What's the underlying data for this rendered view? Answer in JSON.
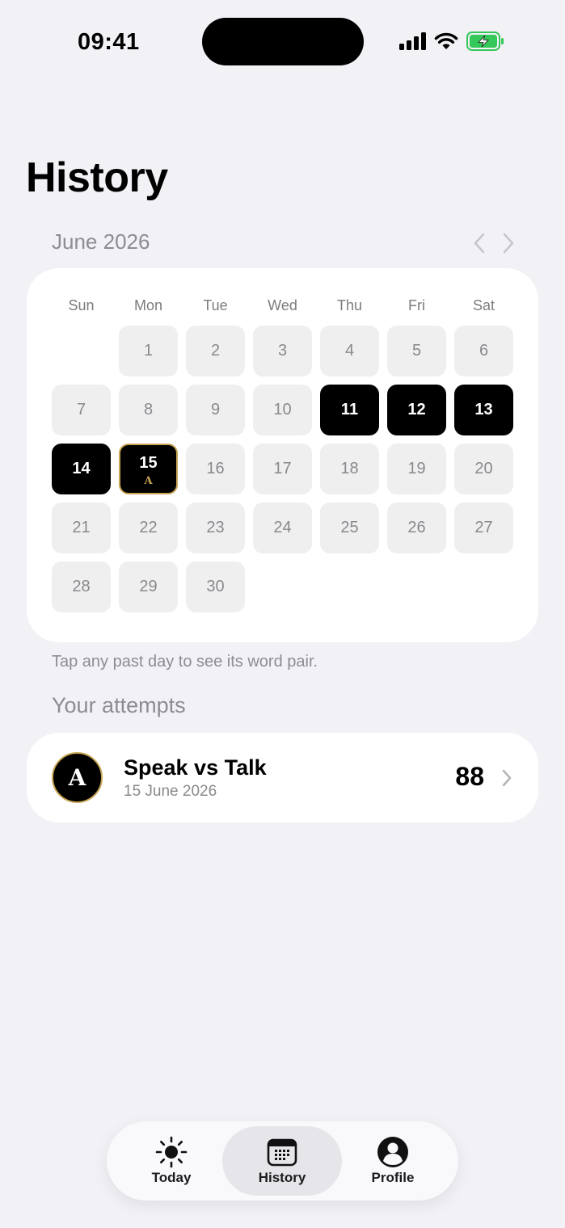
{
  "status_bar": {
    "time": "09:41"
  },
  "page": {
    "title": "History"
  },
  "calendar": {
    "month_label": "June 2026",
    "weekdays": [
      "Sun",
      "Mon",
      "Tue",
      "Wed",
      "Thu",
      "Fri",
      "Sat"
    ],
    "leading_blanks": 1,
    "days": [
      {
        "n": "1",
        "state": "future"
      },
      {
        "n": "2",
        "state": "future"
      },
      {
        "n": "3",
        "state": "future"
      },
      {
        "n": "4",
        "state": "future"
      },
      {
        "n": "5",
        "state": "future"
      },
      {
        "n": "6",
        "state": "future"
      },
      {
        "n": "7",
        "state": "future"
      },
      {
        "n": "8",
        "state": "future"
      },
      {
        "n": "9",
        "state": "future"
      },
      {
        "n": "10",
        "state": "future"
      },
      {
        "n": "11",
        "state": "done"
      },
      {
        "n": "12",
        "state": "done"
      },
      {
        "n": "13",
        "state": "done"
      },
      {
        "n": "14",
        "state": "done"
      },
      {
        "n": "15",
        "state": "today",
        "grade": "A"
      },
      {
        "n": "16",
        "state": "future"
      },
      {
        "n": "17",
        "state": "future"
      },
      {
        "n": "18",
        "state": "future"
      },
      {
        "n": "19",
        "state": "future"
      },
      {
        "n": "20",
        "state": "future"
      },
      {
        "n": "21",
        "state": "future"
      },
      {
        "n": "22",
        "state": "future"
      },
      {
        "n": "23",
        "state": "future"
      },
      {
        "n": "24",
        "state": "future"
      },
      {
        "n": "25",
        "state": "future"
      },
      {
        "n": "26",
        "state": "future"
      },
      {
        "n": "27",
        "state": "future"
      },
      {
        "n": "28",
        "state": "future"
      },
      {
        "n": "29",
        "state": "future"
      },
      {
        "n": "30",
        "state": "future"
      }
    ]
  },
  "hint": "Tap any past day to see its word pair.",
  "attempts": {
    "section_title": "Your attempts",
    "items": [
      {
        "grade": "A",
        "title": "Speak vs Talk",
        "date": "15 June 2026",
        "score": "88"
      }
    ]
  },
  "tab_bar": {
    "tabs": [
      {
        "label": "Today",
        "icon": "sun-icon"
      },
      {
        "label": "History",
        "icon": "calendar-icon",
        "active": true
      },
      {
        "label": "Profile",
        "icon": "person-icon"
      }
    ]
  },
  "colors": {
    "background": "#f2f1f6",
    "gold": "#c7a654",
    "battery_green": "#34c759"
  }
}
